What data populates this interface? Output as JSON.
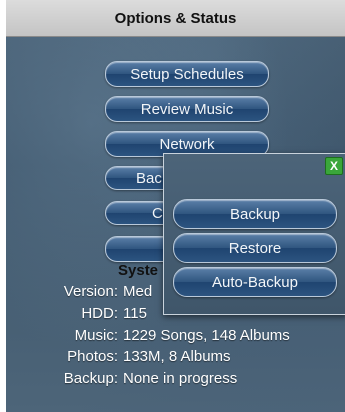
{
  "window": {
    "title": "Options & Status"
  },
  "menu": [
    {
      "name": "setup-schedules-button",
      "label": "Setup Schedules"
    },
    {
      "name": "review-music-button",
      "label": "Review Music"
    },
    {
      "name": "network-button",
      "label": "Network"
    },
    {
      "name": "backup-menu-button",
      "label": "Bac"
    },
    {
      "name": "menu-button-5",
      "label": "C"
    },
    {
      "name": "menu-button-6",
      "label": ""
    }
  ],
  "system": {
    "title": "Syste",
    "rows": [
      {
        "label": "Version:",
        "value": "Med"
      },
      {
        "label": "HDD:",
        "value": "115"
      },
      {
        "label": "Music:",
        "value": "1229 Songs, 148 Albums"
      },
      {
        "label": "Photos:",
        "value": "133M, 8 Albums"
      },
      {
        "label": "Backup:",
        "value": "None in progress"
      }
    ]
  },
  "popup": {
    "close_label": "X",
    "buttons": [
      {
        "name": "backup-button",
        "label": "Backup"
      },
      {
        "name": "restore-button",
        "label": "Restore"
      },
      {
        "name": "auto-backup-button",
        "label": "Auto-Backup"
      }
    ]
  }
}
